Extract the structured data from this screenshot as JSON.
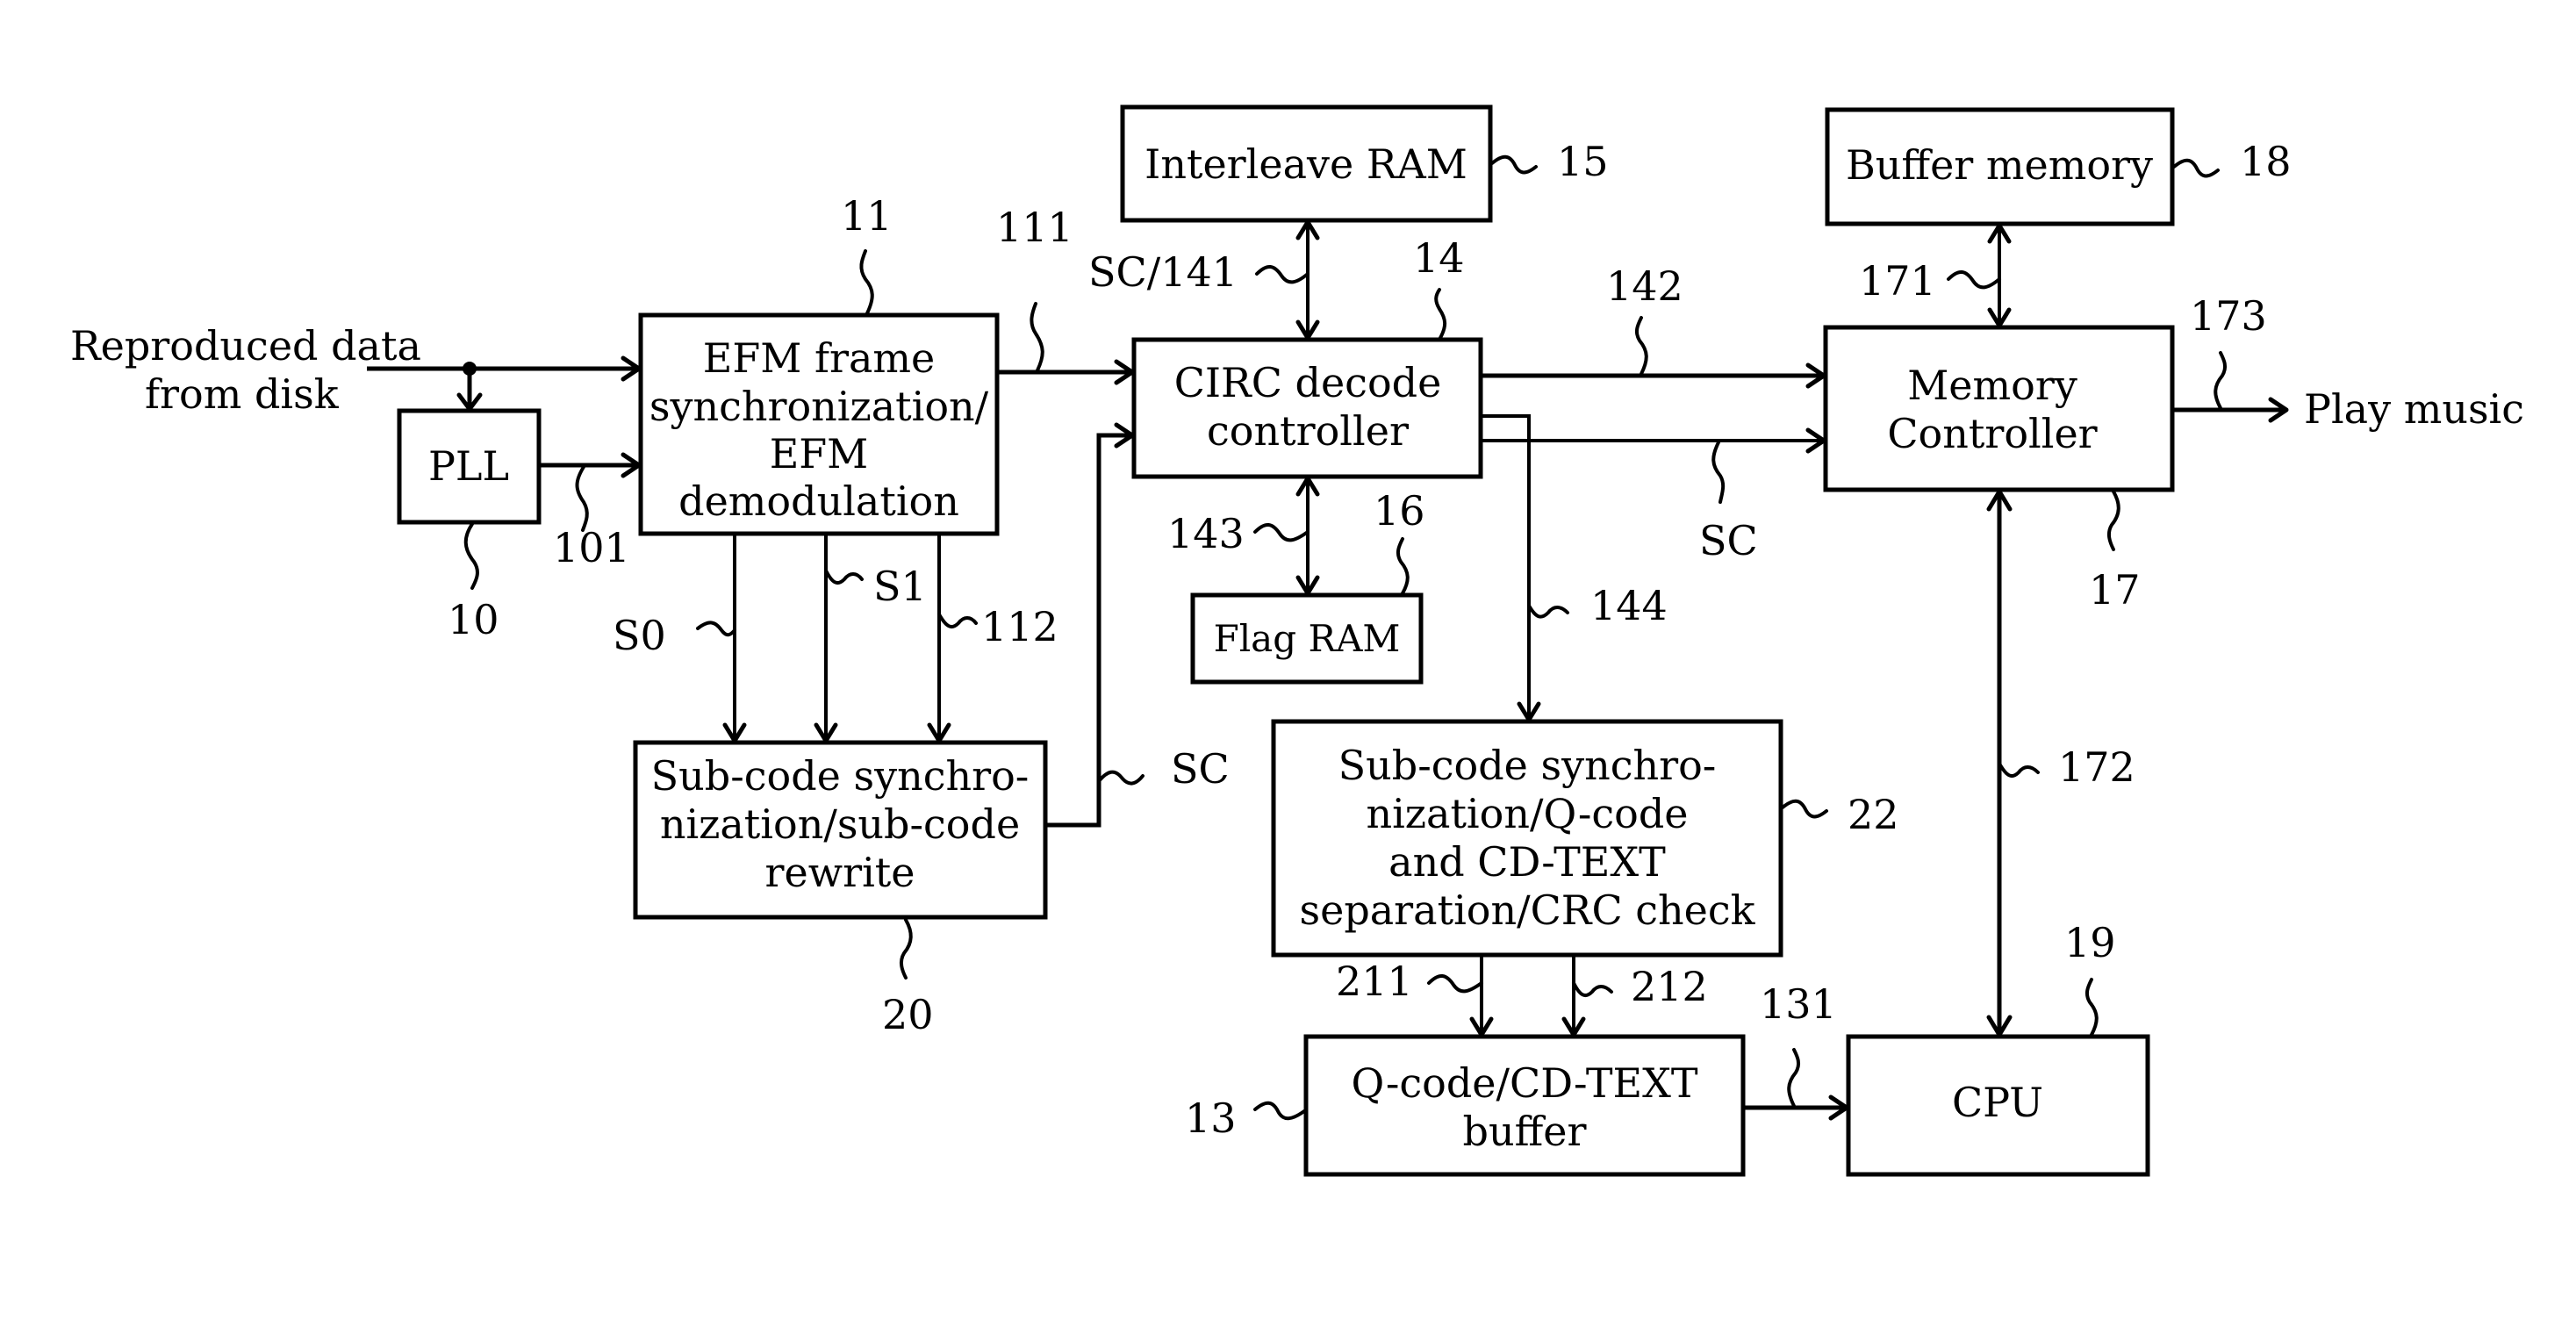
{
  "blocks": {
    "pll": {
      "lines": [
        "PLL"
      ],
      "ref": "10"
    },
    "efm": {
      "lines": [
        "EFM frame",
        "synchronization/",
        "EFM",
        "demodulation"
      ],
      "ref": "11"
    },
    "subcode_rewrite": {
      "lines": [
        "Sub-code synchro-",
        "nization/sub-code",
        "rewrite"
      ],
      "ref": "20"
    },
    "interleave_ram": {
      "lines": [
        "Interleave RAM"
      ],
      "ref": "15"
    },
    "circ": {
      "lines": [
        "CIRC decode",
        "controller"
      ],
      "ref": "14"
    },
    "flag_ram": {
      "lines": [
        "Flag RAM"
      ],
      "ref": "16"
    },
    "buffer_memory": {
      "lines": [
        "Buffer memory"
      ],
      "ref": "18"
    },
    "memory_controller": {
      "lines": [
        "Memory",
        "Controller"
      ],
      "ref": "17"
    },
    "subcode_q": {
      "lines": [
        "Sub-code synchro-",
        "nization/Q-code",
        "and CD-TEXT",
        "separation/CRC check"
      ],
      "ref": "22"
    },
    "qcode_buffer": {
      "lines": [
        "Q-code/CD-TEXT",
        "buffer"
      ],
      "ref": "13"
    },
    "cpu": {
      "lines": [
        "CPU"
      ],
      "ref": "19"
    }
  },
  "io": {
    "input_lines": [
      "Reproduced data",
      "from disk"
    ],
    "output": "Play music"
  },
  "signals": {
    "s101": "101",
    "s111": "111",
    "s112": "112",
    "s0": "S0",
    "s1": "S1",
    "sc_rewrite": "SC",
    "sc141": "SC/141",
    "s142": "142",
    "sc_mem": "SC",
    "s143": "143",
    "s144": "144",
    "s171": "171",
    "s172": "172",
    "s173": "173",
    "s211": "211",
    "s212": "212",
    "s131": "131"
  }
}
